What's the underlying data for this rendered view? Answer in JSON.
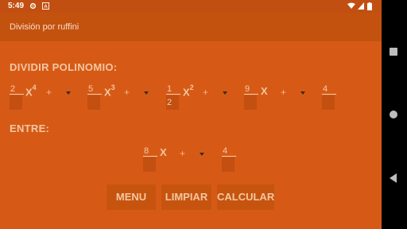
{
  "status_bar": {
    "time": "5:49",
    "icons": [
      "gear-icon",
      "a-icon",
      "wifi-icon",
      "signal-icon",
      "battery-icon"
    ]
  },
  "app_bar": {
    "title": "División por ruffini"
  },
  "dividend": {
    "label": "DIVIDIR POLINOMIO:",
    "terms": [
      {
        "coef": "2",
        "var": "X",
        "exp": "4",
        "op": "+"
      },
      {
        "coef": "5",
        "var": "X",
        "exp": "3",
        "op": "+"
      },
      {
        "coef": "1",
        "denominator": "2",
        "var": "X",
        "exp": "2",
        "op": "+"
      },
      {
        "coef": "9",
        "var": "X",
        "exp": "",
        "op": "+"
      },
      {
        "coef": "4"
      }
    ]
  },
  "divisor": {
    "label": "ENTRE:",
    "coef": "8",
    "var": "X",
    "op": "+",
    "constant": "4"
  },
  "buttons": {
    "menu": "MENU",
    "clear": "LIMPIAR",
    "calculate": "CALCULAR"
  },
  "colors": {
    "background": "#D65A16",
    "appbar": "#C4520F",
    "text": "#F4C7A2"
  }
}
